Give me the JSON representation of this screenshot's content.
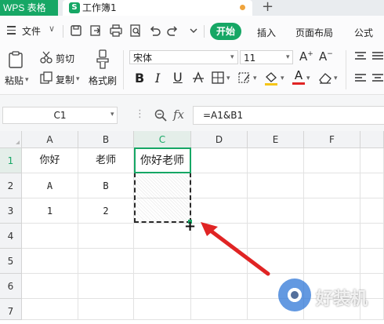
{
  "app": {
    "name": "WPS 表格",
    "accent": "#16a765"
  },
  "document": {
    "title": "工作簿1",
    "icon_letter": "S",
    "unsaved_dot_color": "#f0a43c"
  },
  "tabs": {
    "new_tab": "+"
  },
  "menu": {
    "file": "文件",
    "quick_icons": [
      "save-icon",
      "export-icon",
      "print-icon",
      "print-preview-icon",
      "undo-icon",
      "redo-icon",
      "more-chevron-icon"
    ],
    "tabs": [
      "开始",
      "插入",
      "页面布局",
      "公式"
    ],
    "active_tab": "开始"
  },
  "ribbon": {
    "cut": "剪切",
    "paste": "粘贴",
    "copy": "复制",
    "format_painter": "格式刷",
    "font_name": "宋体",
    "font_size": "11",
    "bold": "B",
    "italic": "I",
    "underline": "U",
    "font_color_letter": "A",
    "grow_font": "A",
    "shrink_font": "A"
  },
  "formula_bar": {
    "name_box": "C1",
    "fx": "fx",
    "formula": "=A1&B1"
  },
  "sheet": {
    "columns": [
      "A",
      "B",
      "C",
      "D",
      "E",
      "F"
    ],
    "rows": [
      "1",
      "2",
      "3",
      "4",
      "5",
      "6",
      "7"
    ],
    "selected_column": "C",
    "selected_row": "1",
    "cells": {
      "A1": "你好",
      "B1": "老师",
      "C1": "你好老师",
      "A2": "A",
      "B2": "B",
      "A3": "1",
      "B3": "2"
    }
  },
  "watermark": {
    "text": "好装机"
  },
  "colors": {
    "accent": "#16a765",
    "arrow": "#e02424",
    "header_bg": "#f2f3f5"
  }
}
